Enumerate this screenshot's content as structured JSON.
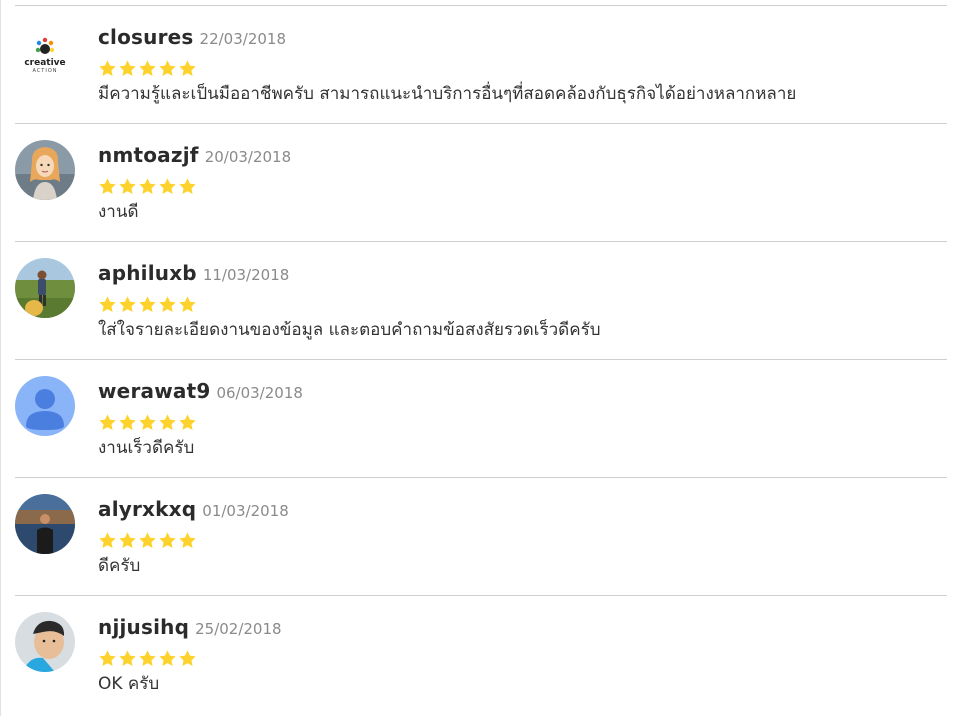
{
  "colors": {
    "star": "#FDD22C",
    "divider": "#cfcfcf",
    "username": "#2b2b2b",
    "date": "#8a8a8a"
  },
  "reviews": [
    {
      "username": "closures",
      "date": "22/03/2018",
      "rating": 5,
      "text": "มีความรู้และเป็นมืออาชีพครับ สามารถแนะนำบริการอื่นๆที่สอดคล้องกับธุรกิจได้อย่างหลากหลาย",
      "avatar": {
        "type": "logo",
        "logo_line1": "creative",
        "logo_line2": "ACTION"
      }
    },
    {
      "username": "nmtoazjf",
      "date": "20/03/2018",
      "rating": 5,
      "text": "งานดี",
      "avatar": {
        "type": "cartoon-person-photo"
      }
    },
    {
      "username": "aphiluxb",
      "date": "11/03/2018",
      "rating": 5,
      "text": "ใส่ใจรายละเอียดงานของข้อมูล และตอบคำถามข้อสงสัยรวดเร็วดีครับ",
      "avatar": {
        "type": "outdoor-person-photo"
      }
    },
    {
      "username": "werawat9",
      "date": "06/03/2018",
      "rating": 5,
      "text": "งานเร็วดีครับ",
      "avatar": {
        "type": "default-user-icon"
      }
    },
    {
      "username": "alyrxkxq",
      "date": "01/03/2018",
      "rating": 5,
      "text": "ดีครับ",
      "avatar": {
        "type": "outdoor-person-photo"
      }
    },
    {
      "username": "njjusihq",
      "date": "25/02/2018",
      "rating": 5,
      "text": "OK ครับ",
      "avatar": {
        "type": "person-selfie-photo"
      }
    }
  ]
}
